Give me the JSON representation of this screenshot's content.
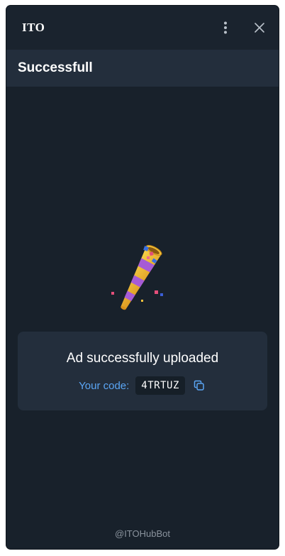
{
  "window": {
    "app_title": "ITO",
    "more_icon": "more-vertical-icon",
    "close_icon": "close-icon"
  },
  "header": {
    "title": "Successfull"
  },
  "result": {
    "illustration": "party-popper-icon",
    "message": "Ad successfully uploaded",
    "code_label": "Your code:",
    "code_value": "4TRTUZ",
    "copy_icon": "copy-icon"
  },
  "footer": {
    "text": "@ITOHubBot"
  },
  "colors": {
    "background": "#18212b",
    "surface": "#232e3c",
    "accent": "#5ba6f5",
    "text_muted": "#8a939d"
  }
}
